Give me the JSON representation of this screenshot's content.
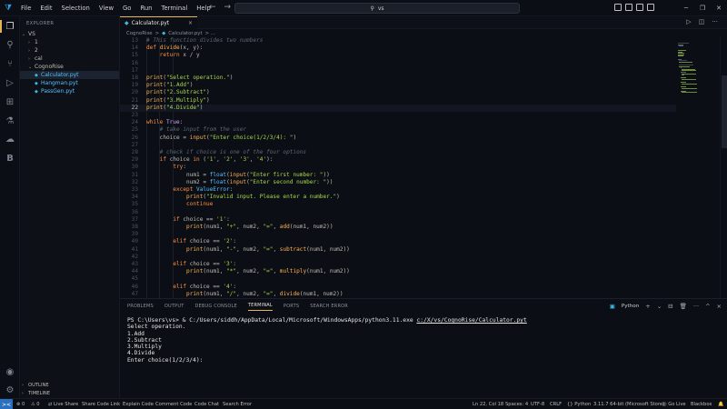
{
  "menu": [
    "File",
    "Edit",
    "Selection",
    "View",
    "Go",
    "Run",
    "Terminal",
    "Help"
  ],
  "search": {
    "text": "vs"
  },
  "sidebar": {
    "header": "EXPLORER",
    "items": [
      {
        "label": "VS",
        "chev": "⌄",
        "indent": 1,
        "kind": "folder"
      },
      {
        "label": "1",
        "chev": "›",
        "indent": 2,
        "kind": "folder"
      },
      {
        "label": "2",
        "chev": "›",
        "indent": 2,
        "kind": "folder"
      },
      {
        "label": "cal",
        "chev": "›",
        "indent": 2,
        "kind": "folder"
      },
      {
        "label": "CognoRise",
        "chev": "⌄",
        "indent": 2,
        "kind": "folder"
      },
      {
        "label": "Calculator.pyt",
        "chev": "",
        "indent": 3,
        "kind": "file",
        "selected": true
      },
      {
        "label": "Hangman.pyt",
        "chev": "",
        "indent": 3,
        "kind": "file"
      },
      {
        "label": "PassGen.pyt",
        "chev": "",
        "indent": 3,
        "kind": "file"
      }
    ],
    "outline": "OUTLINE",
    "timeline": "TIMELINE"
  },
  "tab": {
    "label": "Calculator.pyt",
    "close": "×"
  },
  "breadcrumbs": {
    "folder": "CognoRise",
    "sep": ">",
    "file": "Calculator.pyt",
    "more": "> ..."
  },
  "editor": {
    "current_line": 22,
    "lines": [
      {
        "n": 13,
        "tokens": [
          {
            "t": "# This function divides two numbers",
            "c": "#5c6773",
            "i": true
          }
        ]
      },
      {
        "n": 14,
        "tokens": [
          {
            "t": "def ",
            "c": "#ff8f40"
          },
          {
            "t": "divide",
            "c": "#ffb454"
          },
          {
            "t": "(x, y):",
            "c": "#bfbdb6"
          }
        ]
      },
      {
        "n": 15,
        "tokens": [
          {
            "t": "    return ",
            "c": "#ff8f40"
          },
          {
            "t": "x / y",
            "c": "#bfbdb6"
          }
        ]
      },
      {
        "n": 16,
        "tokens": []
      },
      {
        "n": 17,
        "tokens": []
      },
      {
        "n": 18,
        "tokens": [
          {
            "t": "print",
            "c": "#ffb454"
          },
          {
            "t": "(",
            "c": "#bfbdb6"
          },
          {
            "t": "\"Select operation.\"",
            "c": "#aad94c"
          },
          {
            "t": ")",
            "c": "#bfbdb6"
          }
        ]
      },
      {
        "n": 19,
        "tokens": [
          {
            "t": "print",
            "c": "#ffb454"
          },
          {
            "t": "(",
            "c": "#bfbdb6"
          },
          {
            "t": "\"1.Add\"",
            "c": "#aad94c"
          },
          {
            "t": ")",
            "c": "#bfbdb6"
          }
        ]
      },
      {
        "n": 20,
        "tokens": [
          {
            "t": "print",
            "c": "#ffb454"
          },
          {
            "t": "(",
            "c": "#bfbdb6"
          },
          {
            "t": "\"2.Subtract\"",
            "c": "#aad94c"
          },
          {
            "t": ")",
            "c": "#bfbdb6"
          }
        ]
      },
      {
        "n": 21,
        "tokens": [
          {
            "t": "print",
            "c": "#ffb454"
          },
          {
            "t": "(",
            "c": "#bfbdb6"
          },
          {
            "t": "\"3.Multiply\"",
            "c": "#aad94c"
          },
          {
            "t": ")",
            "c": "#bfbdb6"
          }
        ]
      },
      {
        "n": 22,
        "tokens": [
          {
            "t": "print",
            "c": "#ffb454"
          },
          {
            "t": "(",
            "c": "#bfbdb6"
          },
          {
            "t": "\"4.Divide\"",
            "c": "#aad94c"
          },
          {
            "t": ")",
            "c": "#bfbdb6"
          }
        ]
      },
      {
        "n": 23,
        "tokens": []
      },
      {
        "n": 24,
        "tokens": [
          {
            "t": "while ",
            "c": "#ff8f40"
          },
          {
            "t": "True",
            "c": "#d2a6ff"
          },
          {
            "t": ":",
            "c": "#bfbdb6"
          }
        ]
      },
      {
        "n": 25,
        "tokens": [
          {
            "t": "    # take input from the user",
            "c": "#5c6773",
            "i": true
          }
        ]
      },
      {
        "n": 26,
        "tokens": [
          {
            "t": "    choice = ",
            "c": "#bfbdb6"
          },
          {
            "t": "input",
            "c": "#ffb454"
          },
          {
            "t": "(",
            "c": "#bfbdb6"
          },
          {
            "t": "\"Enter choice(1/2/3/4): \"",
            "c": "#aad94c"
          },
          {
            "t": ")",
            "c": "#bfbdb6"
          }
        ]
      },
      {
        "n": 27,
        "tokens": []
      },
      {
        "n": 28,
        "tokens": [
          {
            "t": "    # check if choice is one of the four options",
            "c": "#5c6773",
            "i": true
          }
        ]
      },
      {
        "n": 29,
        "tokens": [
          {
            "t": "    if ",
            "c": "#ff8f40"
          },
          {
            "t": "choice ",
            "c": "#bfbdb6"
          },
          {
            "t": "in ",
            "c": "#ff8f40"
          },
          {
            "t": "(",
            "c": "#bfbdb6"
          },
          {
            "t": "'1'",
            "c": "#aad94c"
          },
          {
            "t": ", ",
            "c": "#bfbdb6"
          },
          {
            "t": "'2'",
            "c": "#aad94c"
          },
          {
            "t": ", ",
            "c": "#bfbdb6"
          },
          {
            "t": "'3'",
            "c": "#aad94c"
          },
          {
            "t": ", ",
            "c": "#bfbdb6"
          },
          {
            "t": "'4'",
            "c": "#aad94c"
          },
          {
            "t": "):",
            "c": "#bfbdb6"
          }
        ]
      },
      {
        "n": 30,
        "tokens": [
          {
            "t": "        try",
            "c": "#ff8f40"
          },
          {
            "t": ":",
            "c": "#bfbdb6"
          }
        ]
      },
      {
        "n": 31,
        "tokens": [
          {
            "t": "            num1 = ",
            "c": "#bfbdb6"
          },
          {
            "t": "float",
            "c": "#59c2ff"
          },
          {
            "t": "(",
            "c": "#bfbdb6"
          },
          {
            "t": "input",
            "c": "#ffb454"
          },
          {
            "t": "(",
            "c": "#bfbdb6"
          },
          {
            "t": "\"Enter first number: \"",
            "c": "#aad94c"
          },
          {
            "t": "))",
            "c": "#bfbdb6"
          }
        ]
      },
      {
        "n": 32,
        "tokens": [
          {
            "t": "            num2 = ",
            "c": "#bfbdb6"
          },
          {
            "t": "float",
            "c": "#59c2ff"
          },
          {
            "t": "(",
            "c": "#bfbdb6"
          },
          {
            "t": "input",
            "c": "#ffb454"
          },
          {
            "t": "(",
            "c": "#bfbdb6"
          },
          {
            "t": "\"Enter second number: \"",
            "c": "#aad94c"
          },
          {
            "t": "))",
            "c": "#bfbdb6"
          }
        ]
      },
      {
        "n": 33,
        "tokens": [
          {
            "t": "        except ",
            "c": "#ff8f40"
          },
          {
            "t": "ValueError",
            "c": "#59c2ff"
          },
          {
            "t": ":",
            "c": "#bfbdb6"
          }
        ]
      },
      {
        "n": 34,
        "tokens": [
          {
            "t": "            ",
            "c": "#bfbdb6"
          },
          {
            "t": "print",
            "c": "#ffb454"
          },
          {
            "t": "(",
            "c": "#bfbdb6"
          },
          {
            "t": "\"Invalid input. Please enter a number.\"",
            "c": "#aad94c"
          },
          {
            "t": ")",
            "c": "#bfbdb6"
          }
        ]
      },
      {
        "n": 35,
        "tokens": [
          {
            "t": "            continue",
            "c": "#ff8f40"
          }
        ]
      },
      {
        "n": 36,
        "tokens": []
      },
      {
        "n": 37,
        "tokens": [
          {
            "t": "        if ",
            "c": "#ff8f40"
          },
          {
            "t": "choice == ",
            "c": "#bfbdb6"
          },
          {
            "t": "'1'",
            "c": "#aad94c"
          },
          {
            "t": ":",
            "c": "#bfbdb6"
          }
        ]
      },
      {
        "n": 38,
        "tokens": [
          {
            "t": "            ",
            "c": "#bfbdb6"
          },
          {
            "t": "print",
            "c": "#ffb454"
          },
          {
            "t": "(num1, ",
            "c": "#bfbdb6"
          },
          {
            "t": "\"+\"",
            "c": "#aad94c"
          },
          {
            "t": ", num2, ",
            "c": "#bfbdb6"
          },
          {
            "t": "\"=\"",
            "c": "#aad94c"
          },
          {
            "t": ", ",
            "c": "#bfbdb6"
          },
          {
            "t": "add",
            "c": "#ffb454"
          },
          {
            "t": "(num1, num2))",
            "c": "#bfbdb6"
          }
        ]
      },
      {
        "n": 39,
        "tokens": []
      },
      {
        "n": 40,
        "tokens": [
          {
            "t": "        elif ",
            "c": "#ff8f40"
          },
          {
            "t": "choice == ",
            "c": "#bfbdb6"
          },
          {
            "t": "'2'",
            "c": "#aad94c"
          },
          {
            "t": ":",
            "c": "#bfbdb6"
          }
        ]
      },
      {
        "n": 41,
        "tokens": [
          {
            "t": "            ",
            "c": "#bfbdb6"
          },
          {
            "t": "print",
            "c": "#ffb454"
          },
          {
            "t": "(num1, ",
            "c": "#bfbdb6"
          },
          {
            "t": "\"-\"",
            "c": "#aad94c"
          },
          {
            "t": ", num2, ",
            "c": "#bfbdb6"
          },
          {
            "t": "\"=\"",
            "c": "#aad94c"
          },
          {
            "t": ", ",
            "c": "#bfbdb6"
          },
          {
            "t": "subtract",
            "c": "#ffb454"
          },
          {
            "t": "(num1, num2))",
            "c": "#bfbdb6"
          }
        ]
      },
      {
        "n": 42,
        "tokens": []
      },
      {
        "n": 43,
        "tokens": [
          {
            "t": "        elif ",
            "c": "#ff8f40"
          },
          {
            "t": "choice == ",
            "c": "#bfbdb6"
          },
          {
            "t": "'3'",
            "c": "#aad94c"
          },
          {
            "t": ":",
            "c": "#bfbdb6"
          }
        ]
      },
      {
        "n": 44,
        "tokens": [
          {
            "t": "            ",
            "c": "#bfbdb6"
          },
          {
            "t": "print",
            "c": "#ffb454"
          },
          {
            "t": "(num1, ",
            "c": "#bfbdb6"
          },
          {
            "t": "\"*\"",
            "c": "#aad94c"
          },
          {
            "t": ", num2, ",
            "c": "#bfbdb6"
          },
          {
            "t": "\"=\"",
            "c": "#aad94c"
          },
          {
            "t": ", ",
            "c": "#bfbdb6"
          },
          {
            "t": "multiply",
            "c": "#ffb454"
          },
          {
            "t": "(num1, num2))",
            "c": "#bfbdb6"
          }
        ]
      },
      {
        "n": 45,
        "tokens": []
      },
      {
        "n": 46,
        "tokens": [
          {
            "t": "        elif ",
            "c": "#ff8f40"
          },
          {
            "t": "choice == ",
            "c": "#bfbdb6"
          },
          {
            "t": "'4'",
            "c": "#aad94c"
          },
          {
            "t": ":",
            "c": "#bfbdb6"
          }
        ]
      },
      {
        "n": 47,
        "tokens": [
          {
            "t": "            ",
            "c": "#bfbdb6"
          },
          {
            "t": "print",
            "c": "#ffb454"
          },
          {
            "t": "(num1, ",
            "c": "#bfbdb6"
          },
          {
            "t": "\"/\"",
            "c": "#aad94c"
          },
          {
            "t": ", num2, ",
            "c": "#bfbdb6"
          },
          {
            "t": "\"=\"",
            "c": "#aad94c"
          },
          {
            "t": ", ",
            "c": "#bfbdb6"
          },
          {
            "t": "divide",
            "c": "#ffb454"
          },
          {
            "t": "(num1, num2))",
            "c": "#bfbdb6"
          }
        ]
      }
    ]
  },
  "panel": {
    "tabs": [
      "PROBLEMS",
      "OUTPUT",
      "DEBUG CONSOLE",
      "TERMINAL",
      "PORTS",
      "SEARCH ERROR"
    ],
    "active_tab": "TERMINAL",
    "terminal_label": "Python",
    "actions": {
      "add": "+",
      "chev": "⌄",
      "split": "⊟",
      "trash": "🗑",
      "more": "···",
      "max": "^",
      "close": "×"
    },
    "terminal": {
      "prompt": "PS C:\\Users\\vs> & C:/Users/siddh/AppData/Local/Microsoft/WindowsApps/python3.11.exe ",
      "script": "c:/X/vs/CognoRise/Calculator.pyt",
      "output": [
        "Select operation.",
        "1.Add",
        "2.Subtract",
        "3.Multiply",
        "4.Divide",
        "Enter choice(1/2/3/4):"
      ]
    }
  },
  "status": {
    "remote": "><",
    "errors": "⊗ 0",
    "warnings": "⚠ 0",
    "ports": "⚲ 0",
    "live_share": "Live Share",
    "share_code_link": "Share Code Link",
    "explain_code": "Explain Code",
    "comment_code": "Comment Code",
    "code_chat": "Code Chat",
    "search_error": "Search Error",
    "position": "Ln 22, Col 18",
    "spaces": "Spaces: 4",
    "encoding": "UTF-8",
    "eol": "CRLF",
    "language": "Python",
    "interpreter": "3.11.7 64-bit (Microsoft Store)",
    "go_live": "Go Live",
    "blackbox": "Blackbox"
  },
  "colors": {
    "accent": "#e6b450",
    "keyword": "#ff8f40",
    "function": "#ffb454",
    "string": "#aad94c",
    "comment": "#5c6773",
    "builtin": "#59c2ff",
    "constant": "#d2a6ff"
  }
}
